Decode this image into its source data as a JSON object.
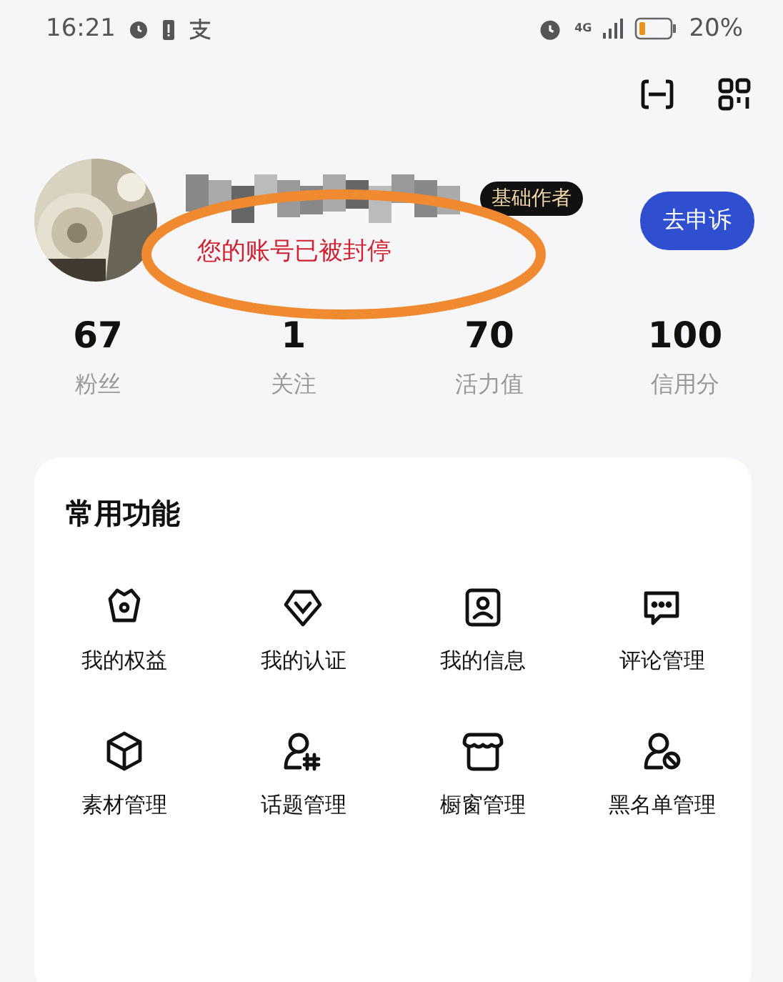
{
  "status_bar": {
    "time": "16:21",
    "network": "4G",
    "battery": "20%"
  },
  "profile": {
    "badge": "基础作者",
    "notice": "您的账号已被封停",
    "appeal_button": "去申诉"
  },
  "stats": [
    {
      "value": "67",
      "label": "粉丝"
    },
    {
      "value": "1",
      "label": "关注"
    },
    {
      "value": "70",
      "label": "活力值"
    },
    {
      "value": "100",
      "label": "信用分"
    }
  ],
  "features": {
    "title": "常用功能",
    "items": [
      {
        "kind": "crown",
        "label": "我的权益"
      },
      {
        "kind": "verify",
        "label": "我的认证"
      },
      {
        "kind": "profile",
        "label": "我的信息"
      },
      {
        "kind": "comment",
        "label": "评论管理"
      },
      {
        "kind": "cube",
        "label": "素材管理"
      },
      {
        "kind": "topic",
        "label": "话题管理"
      },
      {
        "kind": "shop",
        "label": "橱窗管理"
      },
      {
        "kind": "block",
        "label": "黑名单管理"
      }
    ]
  }
}
